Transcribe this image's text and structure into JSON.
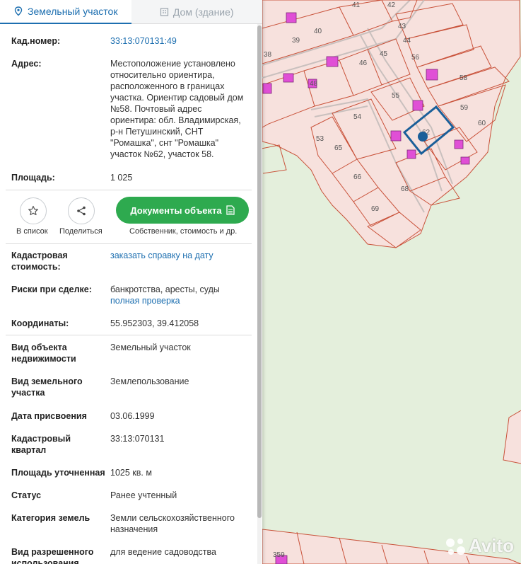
{
  "tabs": [
    {
      "label": "Земельный участок",
      "active": true
    },
    {
      "label": "Дом (здание)",
      "active": false
    }
  ],
  "fields": {
    "cad_number": {
      "label": "Кад.номер:",
      "value": "33:13:070131:49"
    },
    "address": {
      "label": "Адрес:",
      "lines": [
        "Местоположение установлено",
        "относительно ориентира,",
        "расположенного в границах",
        "участка. Ориентир садовый дом",
        "№58. Почтовый адрес",
        "ориентира: обл. Владимирская,",
        "р-н Петушинский, СНТ",
        "\"Ромашка\", снт \"Ромашка\"",
        "участок №62, участок 58."
      ]
    },
    "area": {
      "label": "Площадь:",
      "value": "1 025"
    },
    "cad_cost": {
      "label_lines": [
        "Кадастровая",
        "стоимость:"
      ],
      "link": "заказать справку на дату"
    },
    "risks": {
      "label": "Риски при сделке:",
      "value": "банкротства, аресты, суды",
      "link": "полная проверка"
    },
    "coords": {
      "label": "Координаты:",
      "value": "55.952303, 39.412058"
    },
    "object_type": {
      "label_lines": [
        "Вид объекта",
        "недвижимости"
      ],
      "value": "Земельный участок"
    },
    "land_type": {
      "label_lines": [
        "Вид земельного",
        "участка"
      ],
      "value": "Землепользование"
    },
    "assign_date": {
      "label": "Дата присвоения",
      "value": "03.06.1999"
    },
    "quarter": {
      "label_lines": [
        "Кадастровый",
        "квартал"
      ],
      "value": "33:13:070131"
    },
    "area_refined": {
      "label": "Площадь уточненная",
      "value": "1025 кв. м"
    },
    "status": {
      "label": "Статус",
      "value": "Ранее учтенный"
    },
    "category": {
      "label": "Категория земель",
      "value_lines": [
        "Земли сельскохозяйственного",
        "назначения"
      ]
    },
    "permitted_use": {
      "label_lines": [
        "Вид разрешенного",
        "использования"
      ],
      "value": "для ведение садоводства"
    }
  },
  "actions": {
    "add_list": "В список",
    "share": "Поделиться",
    "documents": "Документы объекта",
    "documents_sub": "Собственник, стоимость и др."
  },
  "map": {
    "parcel_labels": [
      "41",
      "42",
      "43",
      "44",
      "40",
      "39",
      "38",
      "56",
      "45",
      "46",
      "58",
      "48",
      "55",
      "59",
      "60",
      "54",
      "53",
      "62",
      "65",
      "66",
      "68",
      "69",
      "359"
    ]
  },
  "watermark": "Avito",
  "colors": {
    "accent": "#1d6fb0",
    "green": "#2eaa4f",
    "parcel": "#f7e1dd",
    "parcel_line": "#c9523a",
    "building": "#e04fd6",
    "selected": "#1a5f99"
  }
}
